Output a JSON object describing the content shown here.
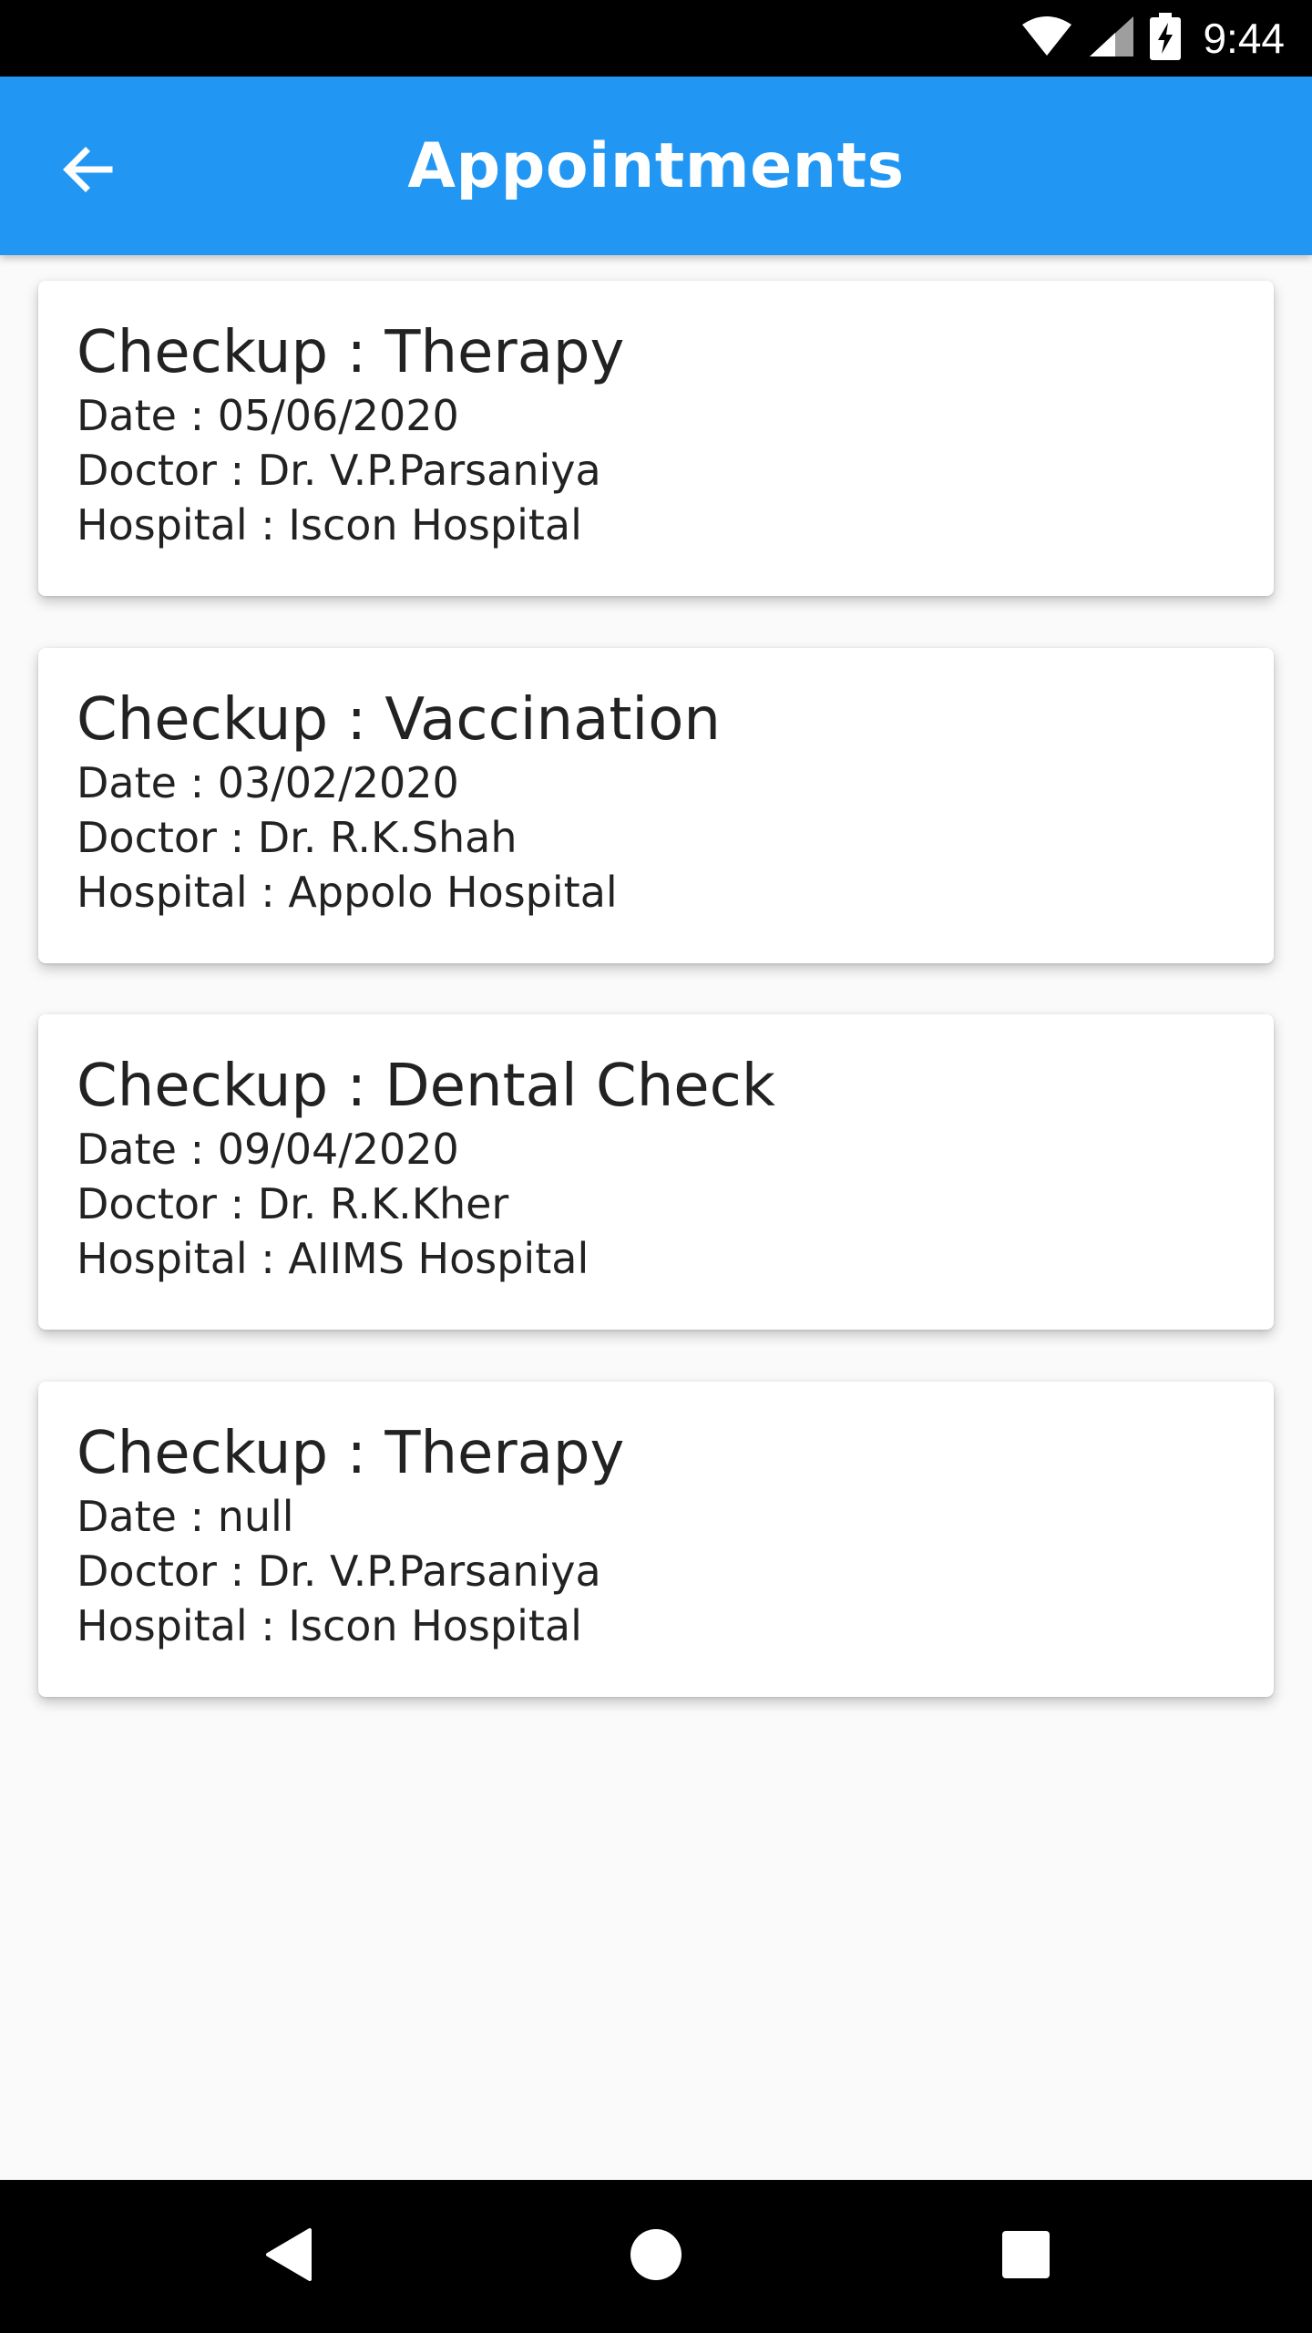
{
  "status_bar": {
    "time": "9:44",
    "icons": [
      "wifi-icon",
      "cell-signal-icon",
      "battery-charging-icon"
    ]
  },
  "app_bar": {
    "title": "Appointments",
    "back_icon": "arrow-back-icon",
    "color": "#2196f3"
  },
  "appointments": [
    {
      "title": "Checkup : Therapy",
      "date": "Date : 05/06/2020",
      "doctor": "Doctor : Dr. V.P.Parsaniya",
      "hospital": "Hospital : Iscon Hospital"
    },
    {
      "title": "Checkup : Vaccination",
      "date": "Date : 03/02/2020",
      "doctor": "Doctor : Dr. R.K.Shah",
      "hospital": "Hospital : Appolo Hospital"
    },
    {
      "title": "Checkup : Dental Check",
      "date": "Date : 09/04/2020",
      "doctor": "Doctor : Dr. R.K.Kher",
      "hospital": "Hospital : AIIMS Hospital"
    },
    {
      "title": "Checkup : Therapy",
      "date": "Date : null",
      "doctor": "Doctor : Dr. V.P.Parsaniya",
      "hospital": "Hospital : Iscon Hospital"
    }
  ],
  "nav_bar": {
    "icons": [
      "back-triangle-icon",
      "home-circle-icon",
      "recents-square-icon"
    ]
  }
}
